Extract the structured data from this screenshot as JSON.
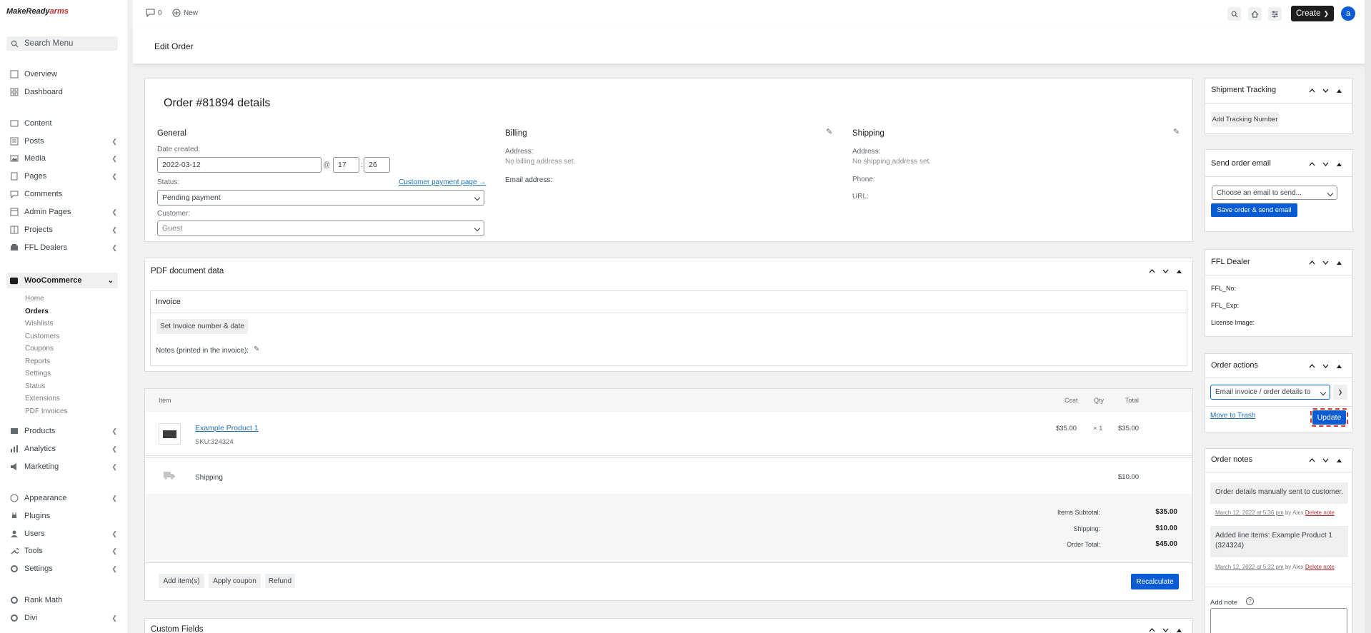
{
  "brand": {
    "logo_main": "MakeReady",
    "logo_accent": "arms"
  },
  "sidebar": {
    "search_placeholder": "Search Menu",
    "items": [
      {
        "label": "Overview"
      },
      {
        "label": "Dashboard"
      },
      {
        "label": "Content"
      },
      {
        "label": "Posts"
      },
      {
        "label": "Media"
      },
      {
        "label": "Pages"
      },
      {
        "label": "Comments"
      },
      {
        "label": "Admin Pages"
      },
      {
        "label": "Projects"
      },
      {
        "label": "FFL Dealers"
      }
    ],
    "woocommerce": {
      "label": "WooCommerce",
      "submenu": [
        "Home",
        "Orders",
        "Wishlists",
        "Customers",
        "Coupons",
        "Reports",
        "Settings",
        "Status",
        "Extensions",
        "PDF Invoices"
      ]
    },
    "items2": [
      {
        "label": "Products"
      },
      {
        "label": "Analytics"
      },
      {
        "label": "Marketing"
      },
      {
        "label": "Appearance"
      },
      {
        "label": "Plugins"
      },
      {
        "label": "Users"
      },
      {
        "label": "Tools"
      },
      {
        "label": "Settings"
      },
      {
        "label": "Rank Math"
      },
      {
        "label": "Divi"
      }
    ]
  },
  "topbar": {
    "comments_count": "0",
    "new_label": "New",
    "create_label": "Create",
    "avatar": "a"
  },
  "page": {
    "title": "Edit Order"
  },
  "order": {
    "heading": "Order #81894 details",
    "general": {
      "title": "General",
      "date_label": "Date created:",
      "date": "2022-03-12",
      "at": "@",
      "hour": "17",
      "colon": ":",
      "minute": "26",
      "status_label": "Status:",
      "payment_link": "Customer payment page →",
      "status": "Pending payment",
      "customer_label": "Customer:",
      "customer_placeholder": "Guest"
    },
    "billing": {
      "title": "Billing",
      "address_label": "Address:",
      "address_value": "No billing address set.",
      "email_label": "Email address:"
    },
    "shipping": {
      "title": "Shipping",
      "address_label": "Address:",
      "address_value": "No shipping address set.",
      "phone_label": "Phone:",
      "url_label": "URL:"
    }
  },
  "pdf": {
    "title": "PDF document data",
    "invoice_title": "Invoice",
    "set_button": "Set Invoice number & date",
    "notes_label": "Notes (printed in the invoice):"
  },
  "items": {
    "headers": {
      "item": "Item",
      "cost": "Cost",
      "qty": "Qty",
      "total": "Total"
    },
    "product": {
      "name": "Example Product 1",
      "sku_label": "SKU:",
      "sku": "324324",
      "cost": "$35.00",
      "qty": "× 1",
      "total": "$35.00"
    },
    "shipping": {
      "name": "Shipping",
      "total": "$10.00"
    },
    "totals": [
      {
        "label": "Items Subtotal:",
        "value": "$35.00"
      },
      {
        "label": "Shipping:",
        "value": "$10.00"
      },
      {
        "label": "Order Total:",
        "value": "$45.00"
      }
    ],
    "buttons": {
      "add": "Add item(s)",
      "coupon": "Apply coupon",
      "refund": "Refund",
      "recalc": "Recalculate"
    }
  },
  "custom_fields": {
    "title": "Custom Fields"
  },
  "side": {
    "tracking": {
      "title": "Shipment Tracking",
      "button": "Add Tracking Number"
    },
    "email": {
      "title": "Send order email",
      "select": "Choose an email to send...",
      "button": "Save order & send email"
    },
    "ffl": {
      "title": "FFL Dealer",
      "no": "FFL_No:",
      "exp": "FFL_Exp:",
      "image": "License Image:"
    },
    "actions": {
      "title": "Order actions",
      "select": "Email invoice / order details to",
      "trash": "Move to Trash",
      "update": "Update"
    },
    "notes": {
      "title": "Order notes",
      "list": [
        {
          "text": "Order details manually sent to customer.",
          "date": "March 12, 2022 at 5:36 pm",
          "by": "by Alex",
          "delete": "Delete note"
        },
        {
          "text": "Added line items: Example Product 1 (324324)",
          "date": "March 12, 2022 at 5:32 pm",
          "by": "by Alex",
          "delete": "Delete note"
        }
      ],
      "add_label": "Add note"
    }
  }
}
